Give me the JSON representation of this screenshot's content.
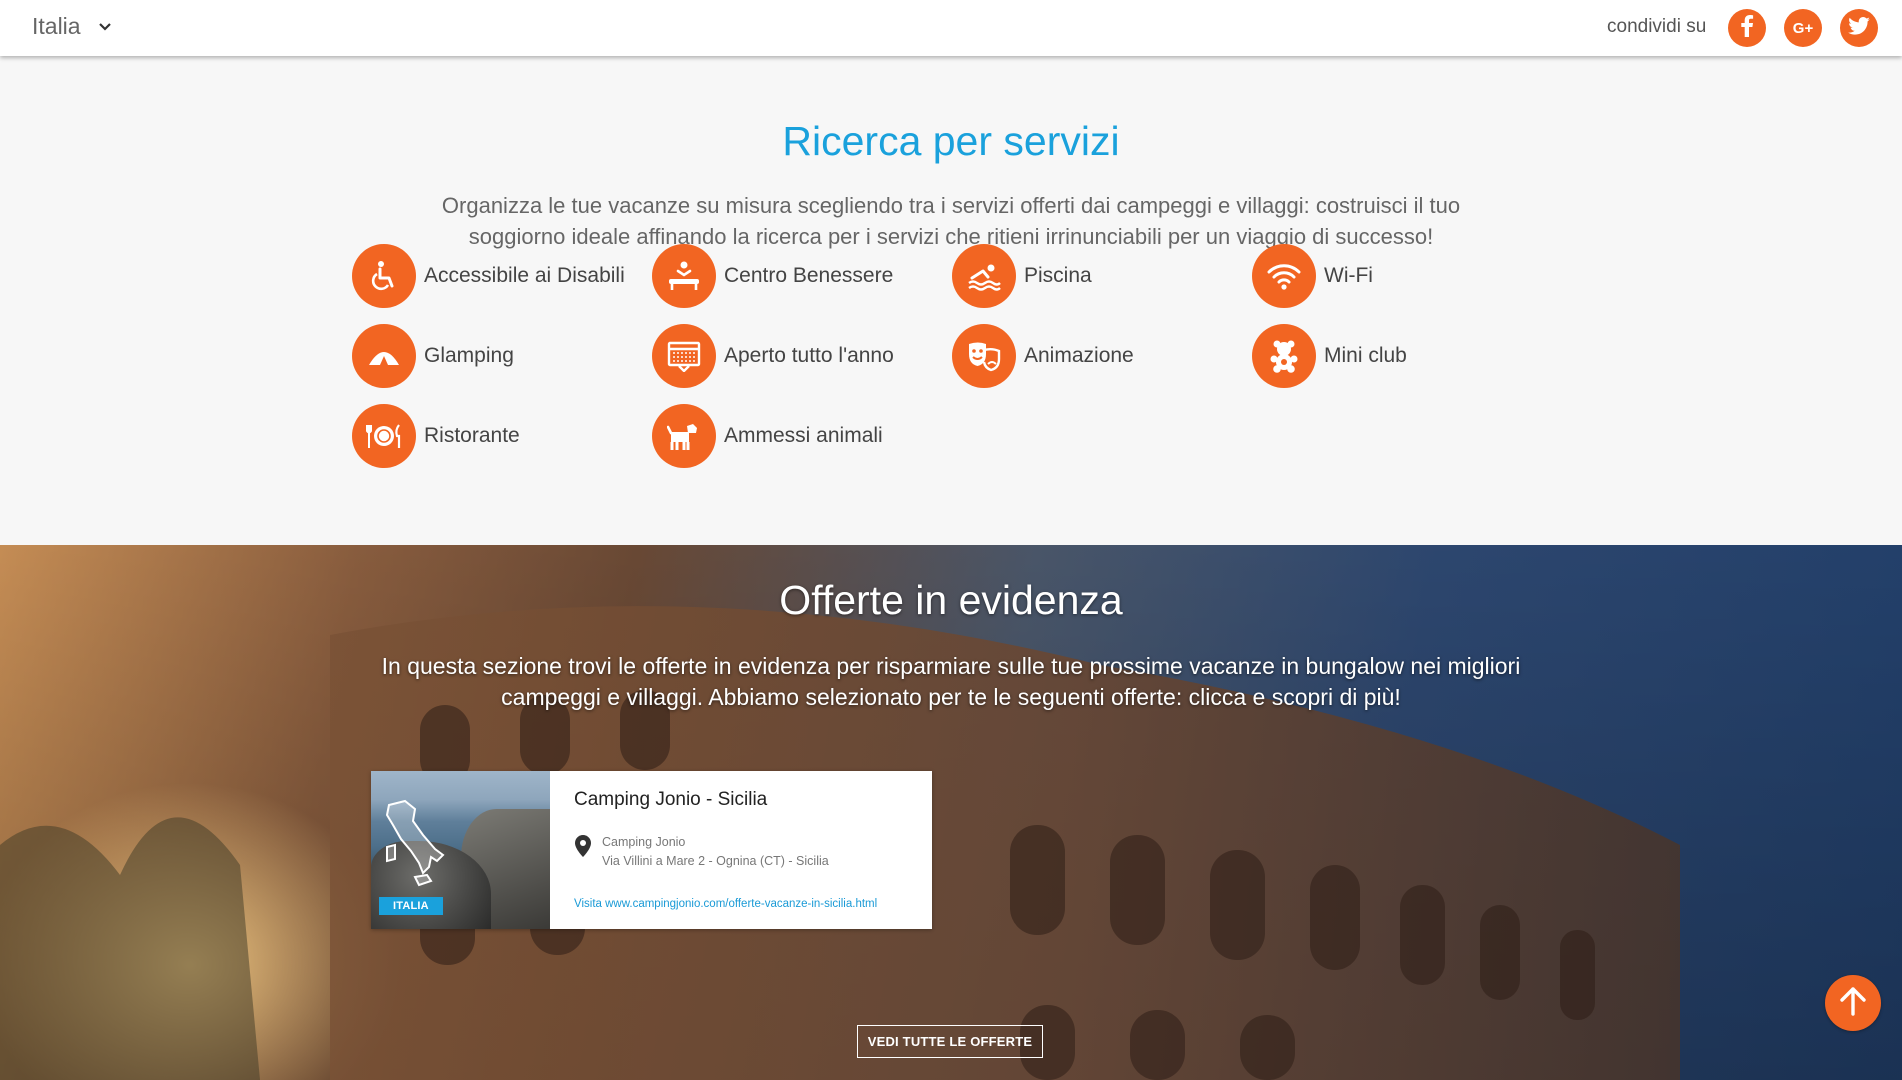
{
  "header": {
    "country": "Italia",
    "share_label": "condividi su",
    "social": [
      {
        "name": "facebook",
        "icon": "facebook-icon"
      },
      {
        "name": "google-plus",
        "icon": "google-plus-icon",
        "glyph": "G+"
      },
      {
        "name": "twitter",
        "icon": "twitter-icon"
      }
    ]
  },
  "services": {
    "title": "Ricerca per servizi",
    "description": "Organizza le tue vacanze su misura scegliendo tra i servizi offerti dai campeggi e villaggi: costruisci il tuo soggiorno ideale affinando la ricerca per i servizi che ritieni irrinunciabili per un viaggio di successo!",
    "items": [
      {
        "label": "Accessibile ai Disabili",
        "icon": "wheelchair-icon"
      },
      {
        "label": "Centro Benessere",
        "icon": "massage-icon"
      },
      {
        "label": "Piscina",
        "icon": "swimmer-icon"
      },
      {
        "label": "Wi-Fi",
        "icon": "wifi-icon"
      },
      {
        "label": "Glamping",
        "icon": "tent-icon"
      },
      {
        "label": "Aperto tutto l'anno",
        "icon": "calendar-icon"
      },
      {
        "label": "Animazione",
        "icon": "theater-masks-icon"
      },
      {
        "label": "Mini club",
        "icon": "teddy-bear-icon"
      },
      {
        "label": "Ristorante",
        "icon": "plate-cutlery-icon"
      },
      {
        "label": "Ammessi animali",
        "icon": "dog-icon"
      }
    ]
  },
  "offers": {
    "title": "Offerte in evidenza",
    "description": "In questa sezione trovi le offerte in evidenza per risparmiare sulle tue prossime vacanze in bungalow nei migliori campeggi e villaggi. Abbiamo selezionato per te le seguenti offerte: clicca e scopri di più!",
    "cards": [
      {
        "title": "Camping Jonio - Sicilia",
        "badge": "ITALIA",
        "name": "Camping Jonio",
        "address": "Via Villini a Mare 2 - Ognina (CT) - Sicilia",
        "link": "Visita www.campingjonio.com/offerte-vacanze-in-sicilia.html"
      }
    ],
    "all_button": "VEDI TUTTE LE OFFERTE"
  },
  "colors": {
    "accent": "#f26522",
    "title_blue": "#1aa1dc",
    "text_gray": "#666666"
  }
}
